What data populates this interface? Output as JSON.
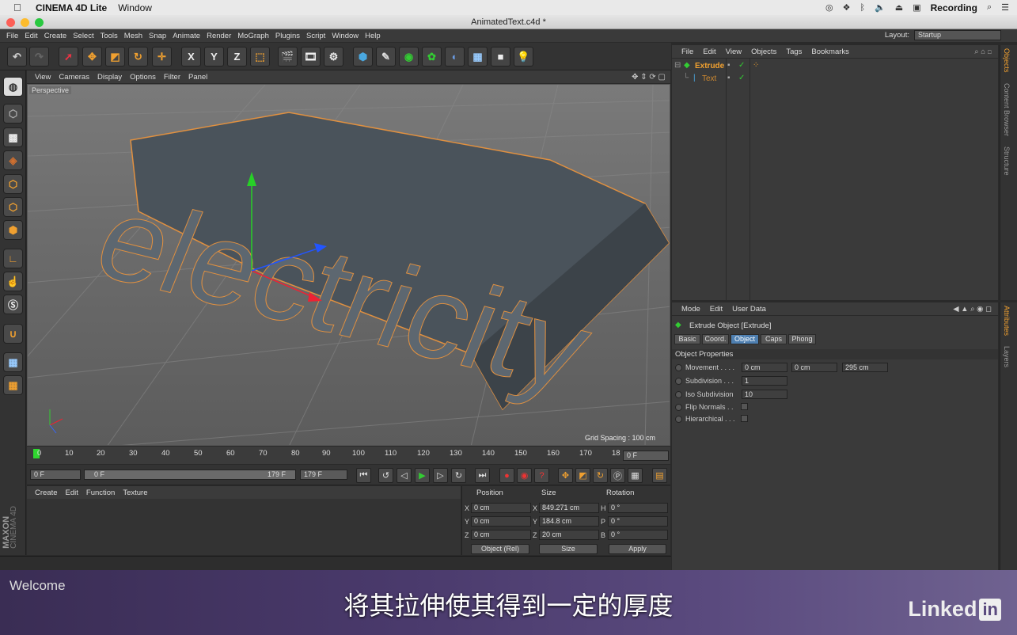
{
  "mac_menu": {
    "apple": "",
    "app_name": "CINEMA 4D Lite",
    "window_menu": "Window",
    "recording": "Recording"
  },
  "window_title": "AnimatedText.c4d *",
  "main_menu": [
    "File",
    "Edit",
    "Create",
    "Select",
    "Tools",
    "Mesh",
    "Snap",
    "Animate",
    "Render",
    "MoGraph",
    "Plugins",
    "Script",
    "Window",
    "Help"
  ],
  "layout": {
    "label": "Layout:",
    "value": "Startup"
  },
  "toolbar": {
    "x_label": "X",
    "y_label": "Y",
    "z_label": "Z"
  },
  "viewport": {
    "menu": [
      "View",
      "Cameras",
      "Display",
      "Options",
      "Filter",
      "Panel"
    ],
    "label": "Perspective",
    "grid_spacing": "Grid Spacing : 100 cm",
    "scene_text": "electricity"
  },
  "timeline": {
    "ticks": [
      "0",
      "10",
      "20",
      "30",
      "40",
      "50",
      "60",
      "70",
      "80",
      "90",
      "100",
      "110",
      "120",
      "130",
      "140",
      "150",
      "160",
      "170",
      "18"
    ],
    "current_frame": "0 F",
    "start_field": "0 F",
    "range_start": "0 F",
    "range_end": "179 F",
    "end_field": "179 F"
  },
  "material": {
    "menu": [
      "Create",
      "Edit",
      "Function",
      "Texture"
    ]
  },
  "coordinates": {
    "headers": {
      "position": "Position",
      "size": "Size",
      "rotation": "Rotation"
    },
    "rows": [
      {
        "axis": "X",
        "pos": "0 cm",
        "size_axis": "X",
        "size": "849.271 cm",
        "rot_axis": "H",
        "rot": "0 °"
      },
      {
        "axis": "Y",
        "pos": "0 cm",
        "size_axis": "Y",
        "size": "184.8 cm",
        "rot_axis": "P",
        "rot": "0 °"
      },
      {
        "axis": "Z",
        "pos": "0 cm",
        "size_axis": "Z",
        "size": "20 cm",
        "rot_axis": "B",
        "rot": "0 °"
      }
    ],
    "mode": "Object (Rel)",
    "size_mode": "Size",
    "apply": "Apply"
  },
  "maxon": {
    "brand": "MAXON",
    "product": "CINEMA 4D"
  },
  "objects": {
    "menu": [
      "File",
      "Edit",
      "View",
      "Objects",
      "Tags",
      "Bookmarks"
    ],
    "items": [
      {
        "name": "Extrude",
        "color": "#f0a030"
      },
      {
        "name": "Text",
        "color": "#d08a30"
      }
    ],
    "side_tabs": [
      "Objects",
      "Content Browser",
      "Structure"
    ]
  },
  "attributes": {
    "menu": [
      "Mode",
      "Edit",
      "User Data"
    ],
    "object_title": "Extrude Object [Extrude]",
    "tabs": [
      "Basic",
      "Coord.",
      "Object",
      "Caps",
      "Phong"
    ],
    "active_tab": "Object",
    "section": "Object Properties",
    "props": {
      "movement_label": "Movement . . . .",
      "movement_x": "0 cm",
      "movement_y": "0 cm",
      "movement_z": "295 cm",
      "subdivision_label": "Subdivision . . .",
      "subdivision": "1",
      "iso_label": "Iso Subdivision",
      "iso": "10",
      "flip_label": "Flip Normals . .",
      "hier_label": "Hierarchical . . ."
    },
    "side_tabs": [
      "Attributes",
      "Layers"
    ]
  },
  "overlay": {
    "welcome": "Welcome",
    "subtitle": "将其拉伸使其得到一定的厚度",
    "brand": "Linked",
    "brand_box": "in"
  }
}
